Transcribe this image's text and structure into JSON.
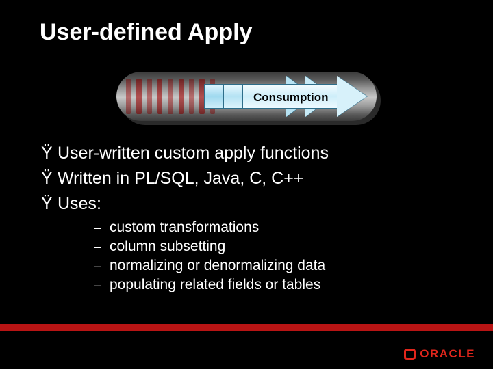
{
  "title": "User-defined Apply",
  "graphic": {
    "label": "Consumption"
  },
  "bullets": [
    {
      "marker": "Ÿ",
      "text": "User-written custom apply functions"
    },
    {
      "marker": "Ÿ",
      "text": "Written in PL/SQL, Java, C, C++"
    },
    {
      "marker": "Ÿ",
      "text": "Uses:"
    }
  ],
  "sub_bullets": [
    {
      "marker": "–",
      "text": "custom transformations"
    },
    {
      "marker": "–",
      "text": "column subsetting"
    },
    {
      "marker": "–",
      "text": "normalizing or denormalizing data"
    },
    {
      "marker": "–",
      "text": "populating related fields or tables"
    }
  ],
  "logo_text": "ORACLE"
}
